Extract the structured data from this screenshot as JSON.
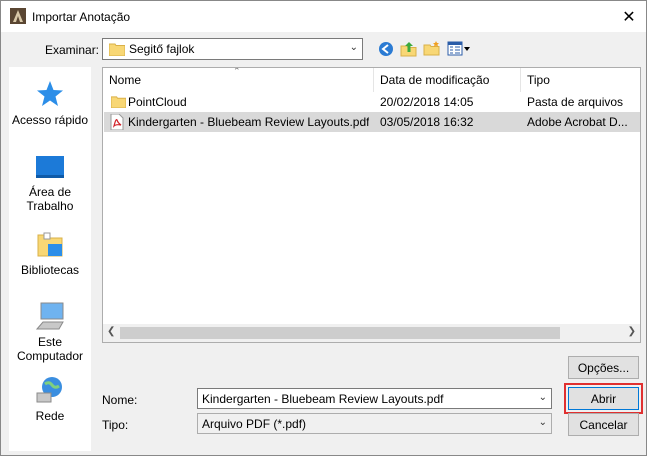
{
  "window": {
    "title": "Importar Anotação"
  },
  "lookin": {
    "label": "Examinar:",
    "value": "Segitő fajlok"
  },
  "toolbar": {
    "back_icon": "back-arrow-icon",
    "up_icon": "up-folder-icon",
    "new_folder_icon": "new-folder-icon",
    "view_icon": "view-menu-icon"
  },
  "places": [
    {
      "label": "Acesso rápido",
      "icon": "star-icon"
    },
    {
      "label": "Área de Trabalho",
      "icon": "desktop-icon"
    },
    {
      "label": "Bibliotecas",
      "icon": "libraries-icon"
    },
    {
      "label": "Este Computador",
      "icon": "computer-icon"
    },
    {
      "label": "Rede",
      "icon": "network-icon"
    }
  ],
  "columns": [
    "Nome",
    "Data de modificação",
    "Tipo"
  ],
  "files": [
    {
      "name": "PointCloud",
      "date": "20/02/2018 14:05",
      "type": "Pasta de arquivos",
      "icon": "folder-icon"
    },
    {
      "name": "Kindergarten - Bluebeam Review Layouts.pdf",
      "date": "03/05/2018 16:32",
      "type": "Adobe Acrobat D...",
      "icon": "pdf-icon"
    }
  ],
  "buttons": {
    "options": "Opções...",
    "open": "Abrir",
    "cancel": "Cancelar"
  },
  "filename": {
    "label": "Nome:",
    "value": "Kindergarten - Bluebeam Review Layouts.pdf"
  },
  "filetype": {
    "label": "Tipo:",
    "value": "Arquivo PDF (*.pdf)"
  },
  "colors": {
    "selection": "#d9d9d9",
    "accent": "#0078d7",
    "highlight": "#e03030"
  }
}
